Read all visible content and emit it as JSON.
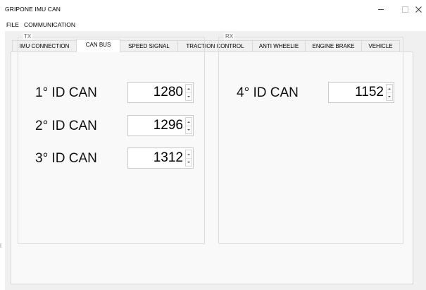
{
  "window": {
    "title": "GRIPONE IMU CAN"
  },
  "menu": [
    {
      "label": "FILE"
    },
    {
      "label": "COMMUNICATION"
    }
  ],
  "tabs": [
    {
      "label": "IMU CONNECTION",
      "active": false
    },
    {
      "label": "CAN BUS",
      "active": true
    },
    {
      "label": "SPEED SIGNAL",
      "active": false
    },
    {
      "label": "TRACTION CONTROL",
      "active": false
    },
    {
      "label": "ANTI WHEELIE",
      "active": false
    },
    {
      "label": "ENGINE BRAKE",
      "active": false
    },
    {
      "label": "VEHICLE",
      "active": false
    }
  ],
  "tx": {
    "label": "TX",
    "fields": [
      {
        "label": "1° ID CAN",
        "value": "1280"
      },
      {
        "label": "2° ID CAN",
        "value": "1296"
      },
      {
        "label": "3° ID CAN",
        "value": "1312"
      }
    ]
  },
  "rx": {
    "label": "RX",
    "fields": [
      {
        "label": "4° ID CAN",
        "value": "1152"
      }
    ]
  }
}
